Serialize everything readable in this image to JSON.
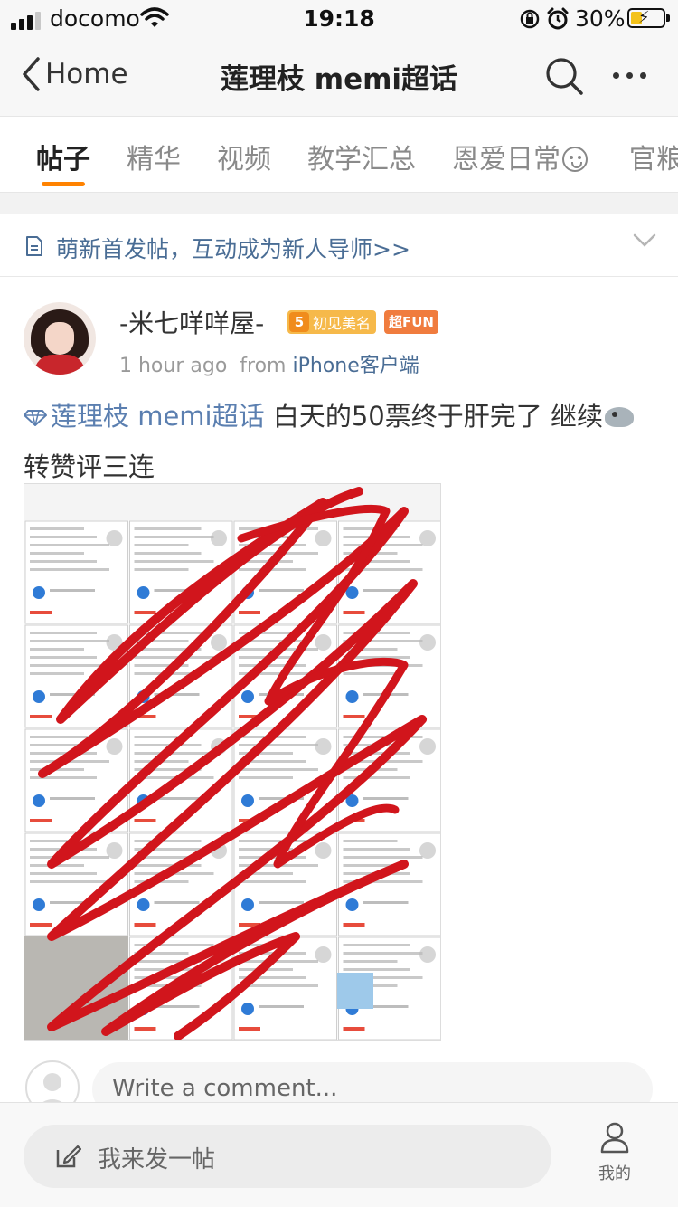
{
  "status_bar": {
    "carrier": "docomo",
    "time": "19:18",
    "battery_percent": "30%",
    "signal_bars_active": 3,
    "battery_level": 0.3,
    "charging": true
  },
  "nav": {
    "back_label": "Home",
    "title": "莲理枝 memi超话"
  },
  "tabs": [
    {
      "label": "帖子",
      "active": true
    },
    {
      "label": "精华"
    },
    {
      "label": "视频"
    },
    {
      "label": "教学汇总"
    },
    {
      "label": "恩爱日常"
    },
    {
      "label": "官粮"
    }
  ],
  "notice": {
    "text": "萌新首发帖，互动成为新人导师>>"
  },
  "post": {
    "author": "-米七咩咩屋-",
    "level_number": "5",
    "level_badge": "初见美名",
    "super_badge": "超FUN",
    "time_ago": "1 hour ago",
    "from_prefix": "from",
    "source": "iPhone客户端",
    "topic_label": "莲理枝 memi超话",
    "text_before_icon": " 白天的50票终于肝完了 继续",
    "text_after_icon": "转赞评三连"
  },
  "comment": {
    "placeholder": "Write a comment..."
  },
  "bottom_bar": {
    "compose_label": "我来发一帖",
    "me_label": "我的"
  },
  "colors": {
    "accent_orange": "#ff8200",
    "link_blue": "#4a6d95",
    "scribble_red": "#d1151c"
  }
}
